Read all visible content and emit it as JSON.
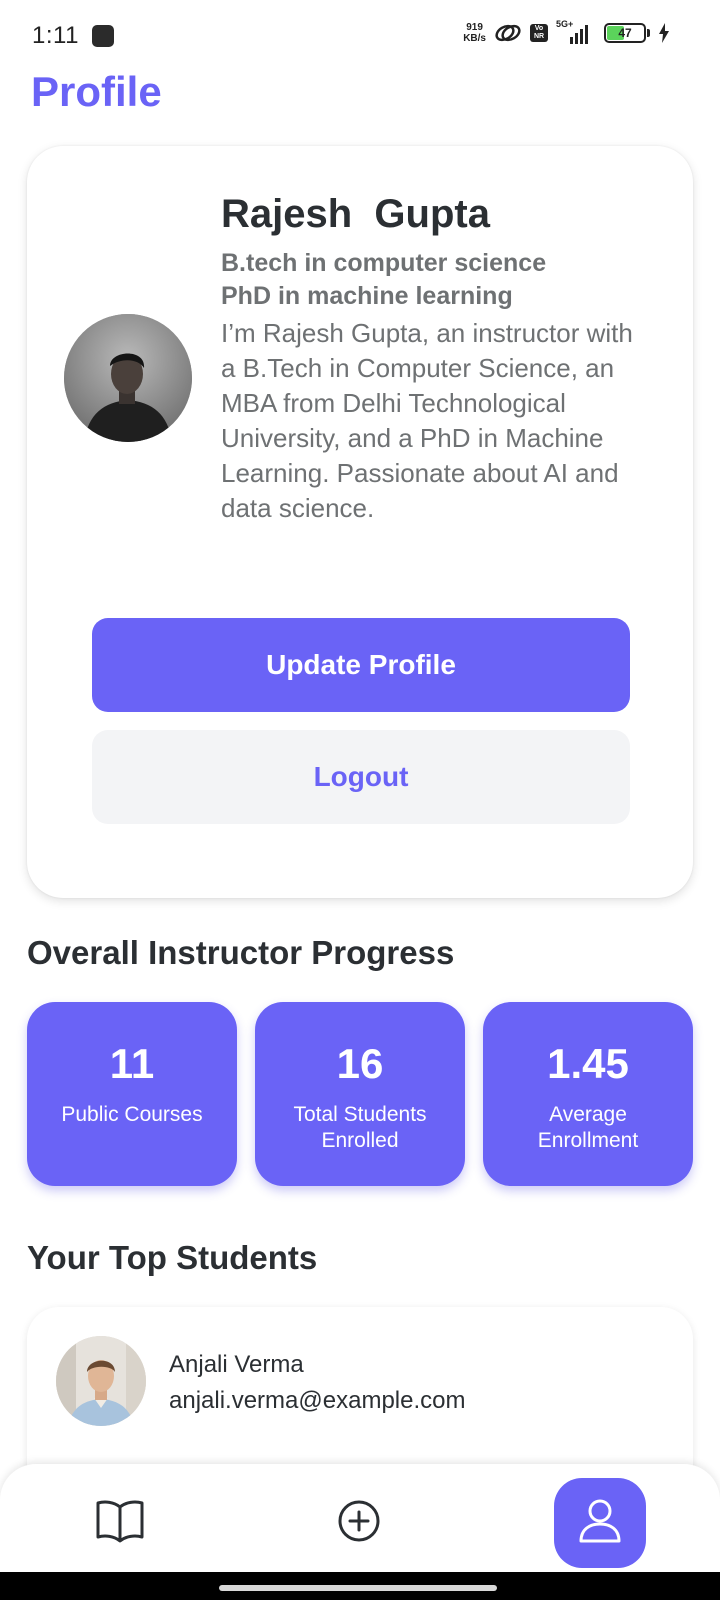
{
  "status_bar": {
    "time": "1:11",
    "net_speed_value": "919",
    "net_speed_unit": "KB/s",
    "network_label": "5G+",
    "volte_top": "Vo",
    "volte_bottom": "NR",
    "battery": "47",
    "battery_level": 0.47
  },
  "page": {
    "title": "Profile"
  },
  "profile": {
    "name": "Rajesh  Gupta",
    "degree_1": "B.tech in computer science",
    "degree_2": "PhD in machine learning",
    "bio": "I’m Rajesh Gupta, an instructor with a B.Tech in Computer Science, an MBA from Delhi Technological University, and a PhD in Machine Learning. Passionate about AI and data science.",
    "update_label": "Update Profile",
    "logout_label": "Logout"
  },
  "progress": {
    "heading": "Overall Instructor Progress",
    "stats": [
      {
        "value": "11",
        "label": "Public Courses"
      },
      {
        "value": "16",
        "label": "Total Students Enrolled"
      },
      {
        "value": "1.45",
        "label": "Average Enrollment"
      }
    ]
  },
  "top_students": {
    "heading": "Your Top Students",
    "items": [
      {
        "name": "Anjali Verma",
        "email": "anjali.verma@example.com"
      }
    ]
  },
  "bottom_nav": {
    "items": [
      {
        "icon": "book-icon"
      },
      {
        "icon": "plus-circle-icon"
      },
      {
        "icon": "user-icon",
        "active": true
      }
    ]
  },
  "colors": {
    "accent": "#6a63f6",
    "text": "#2b2f33",
    "muted": "#6e7173",
    "logout_bg": "#f3f4f6"
  }
}
